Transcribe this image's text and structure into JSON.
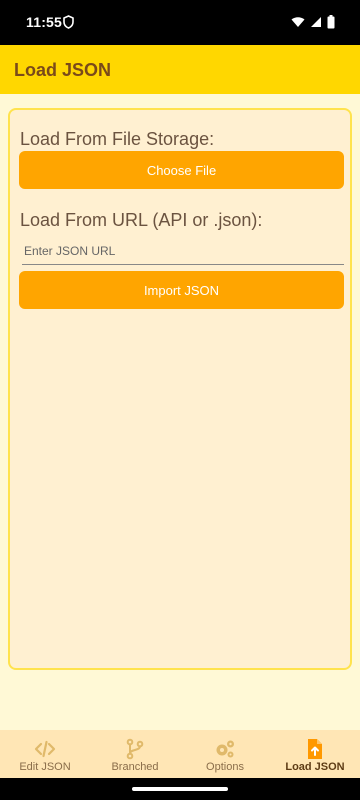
{
  "status": {
    "time": "11:55"
  },
  "app_bar": {
    "title": "Load JSON"
  },
  "file_section": {
    "label": "Load From File Storage:",
    "button_label": "Choose File"
  },
  "url_section": {
    "label": "Load From URL (API or .json):",
    "input_placeholder": "Enter JSON URL",
    "input_value": "",
    "button_label": "Import JSON"
  },
  "bottom_nav": {
    "items": [
      {
        "label": "Edit JSON",
        "icon": "code-icon",
        "active": false
      },
      {
        "label": "Branched",
        "icon": "branch-icon",
        "active": false
      },
      {
        "label": "Options",
        "icon": "gears-icon",
        "active": false
      },
      {
        "label": "Load JSON",
        "icon": "file-upload-icon",
        "active": true
      }
    ]
  },
  "colors": {
    "app_bar": "#ffd700",
    "accent_button": "#ffa500",
    "panel_bg": "#fff0d1",
    "panel_border": "#ffe34d",
    "nav_bg": "#ffe6b5",
    "active_icon": "#ff9800",
    "inactive_icon": "#e0b96a"
  }
}
